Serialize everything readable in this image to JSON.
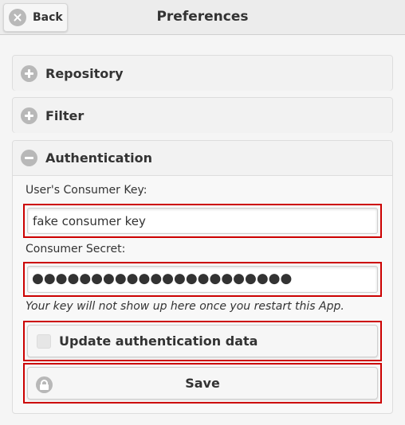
{
  "header": {
    "back_label": "Back",
    "title": "Preferences"
  },
  "sections": {
    "repository": {
      "title": "Repository",
      "expanded": false
    },
    "filter": {
      "title": "Filter",
      "expanded": false
    },
    "authentication": {
      "title": "Authentication",
      "expanded": true,
      "consumer_key_label": "User's Consumer Key:",
      "consumer_key_value": "fake consumer key",
      "consumer_secret_label": "Consumer Secret:",
      "consumer_secret_masked": "●●●●●●●●●●●●●●●●●●●●●●",
      "hint": "Your key will not show up here once you restart this App.",
      "update_checkbox_label": "Update authentication data",
      "update_checkbox_checked": false,
      "save_label": "Save"
    }
  },
  "colors": {
    "highlight_border": "#cc0000",
    "icon_gray": "#b8b8b8"
  }
}
